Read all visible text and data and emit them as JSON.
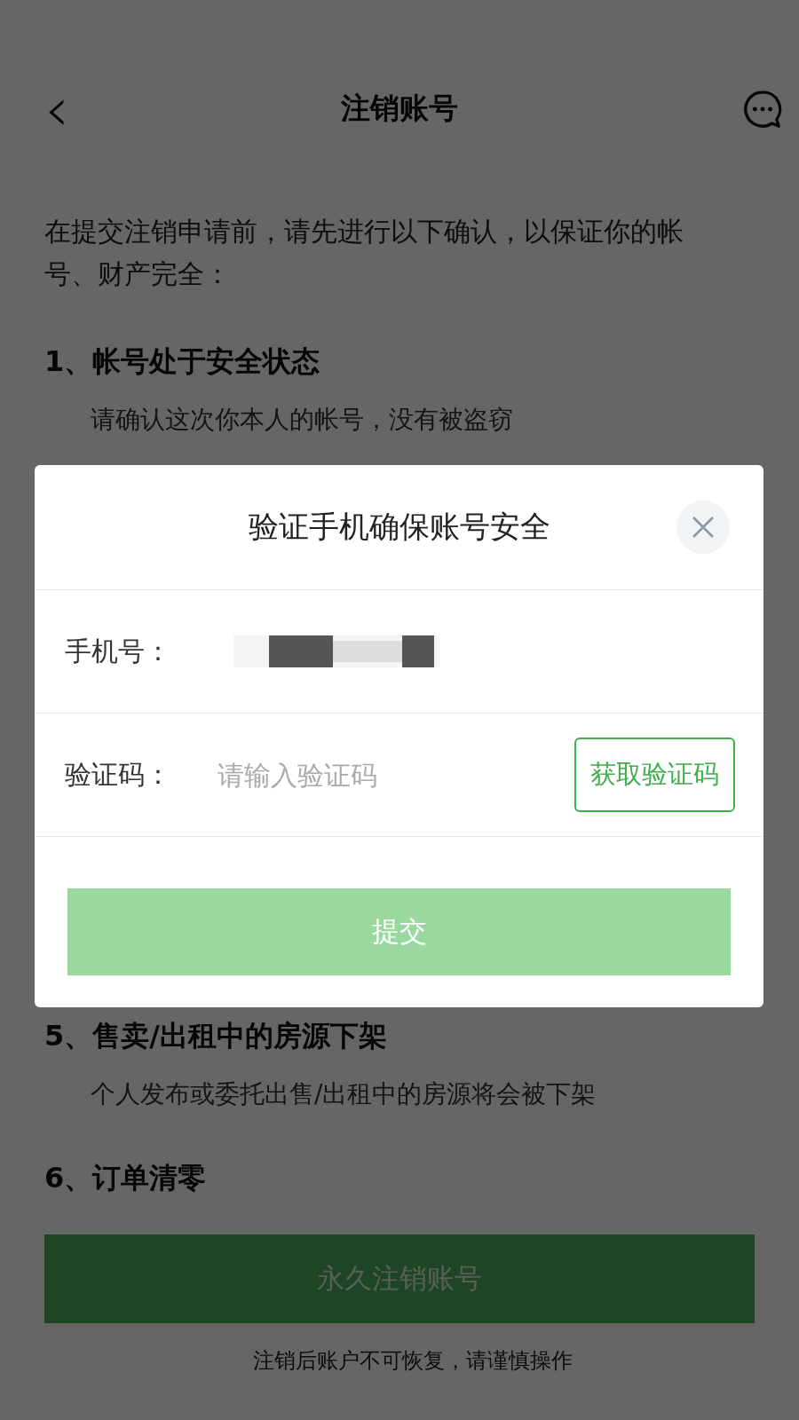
{
  "header": {
    "back": "‹",
    "title": "注销账号"
  },
  "intro": "在提交注销申请前，请先进行以下确认，以保证你的帐号、财产完全：",
  "conditions_top": [
    {
      "title": "1、帐号处于安全状态",
      "detail": "请确认这次你本人的帐号，没有被盗窃"
    }
  ],
  "conditions_bottom": [
    {
      "title": "5、售卖/出租中的房源下架",
      "detail": "个人发布或委托出售/出租中的房源将会被下架"
    },
    {
      "title": "6、订单清零"
    }
  ],
  "cancel_button": "永久注销账号",
  "footer_note": "注销后账户不可恢复，请谨慎操作",
  "dialog": {
    "title": "验证手机确保账号安全",
    "phone_label": "手机号：",
    "code_label": "验证码：",
    "code_placeholder": "请输入验证码",
    "get_code_button": "获取验证码",
    "submit_button": "提交",
    "submit_disabled": true
  }
}
